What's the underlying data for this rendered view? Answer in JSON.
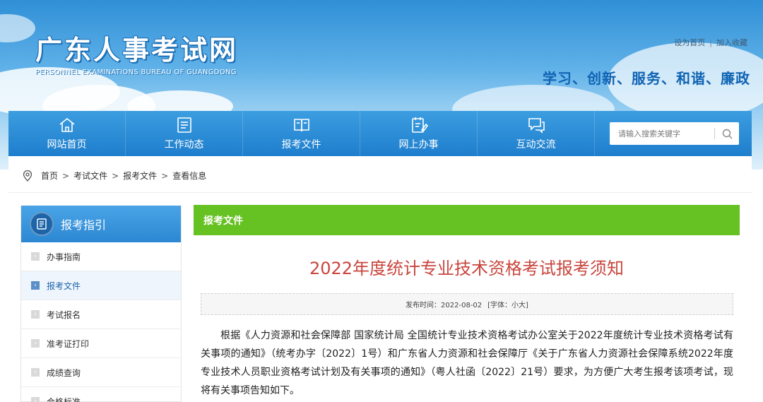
{
  "header": {
    "title": "广东人事考试网",
    "subtitle": "PERSONNEL EXAMINATIONS BUREAU OF GUANGDONG",
    "set_home": "设为首页",
    "separator": "|",
    "add_favorite": "加入收藏",
    "slogan": "学习、创新、服务、和谐、廉政"
  },
  "nav": {
    "items": [
      {
        "label": "网站首页",
        "icon": "home-icon"
      },
      {
        "label": "工作动态",
        "icon": "document-list-icon"
      },
      {
        "label": "报考文件",
        "icon": "open-book-icon"
      },
      {
        "label": "网上办事",
        "icon": "clipboard-edit-icon"
      },
      {
        "label": "互动交流",
        "icon": "chat-bubbles-icon"
      }
    ],
    "search_placeholder": "请输入搜索关键字"
  },
  "breadcrumb": {
    "items": [
      "首页",
      "考试文件",
      "报考文件",
      "查看信息"
    ],
    "separator": ">"
  },
  "sidebar": {
    "title": "报考指引",
    "items": [
      {
        "label": "办事指南",
        "active": false
      },
      {
        "label": "报考文件",
        "active": true
      },
      {
        "label": "考试报名",
        "active": false
      },
      {
        "label": "准考证打印",
        "active": false
      },
      {
        "label": "成绩查询",
        "active": false
      },
      {
        "label": "合格标准",
        "active": false
      }
    ]
  },
  "main": {
    "section_title": "报考文件",
    "article_title": "2022年度统计专业技术资格考试报考须知",
    "publish_label": "发布时间：2022-08-02",
    "font_label": "[字体：小大]",
    "body": "根据《人力资源和社会保障部 国家统计局 全国统计专业技术资格考试办公室关于2022年度统计专业技术资格考试有关事项的通知》（统考办字〔2022〕1号）和广东省人力资源和社会保障厅《关于广东省人力资源社会保障系统2022年度专业技术人员职业资格考试计划及有关事项的通知》（粤人社函〔2022〕21号）要求，为方便广大考生报考该项考试，现将有关事项告知如下。"
  },
  "colors": {
    "nav_blue": "#1e7ecd",
    "section_green": "#66c122",
    "title_red": "#c9453d",
    "slogan_blue": "#0f63b3"
  }
}
